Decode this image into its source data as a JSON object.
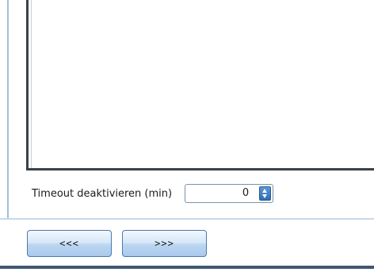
{
  "timeout": {
    "label": "Timeout deaktivieren (min)",
    "value": "0"
  },
  "navigation": {
    "prev_label": "<<<",
    "next_label": ">>>"
  },
  "colors": {
    "spin_accent": "#2f6db6",
    "button_border": "#4b79ad",
    "bottom_bar": "#3f5873"
  }
}
